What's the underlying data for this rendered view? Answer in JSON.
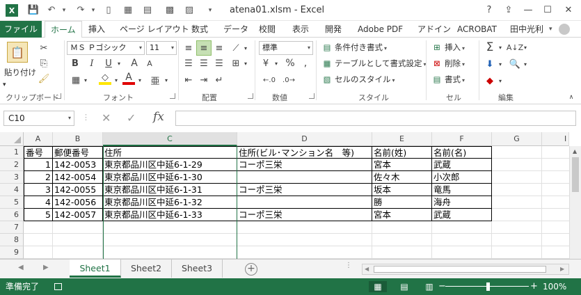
{
  "window": {
    "title": "atena01.xlsm - Excel",
    "app_badge": "X",
    "help": "?",
    "ribbon_options": "⇪",
    "minimize": "—",
    "maximize": "☐",
    "close": "✕"
  },
  "quick_access": {
    "save": "💾",
    "undo": "↶",
    "redo": "↷",
    "new": "▯",
    "customize": "▾"
  },
  "ribbon_tabs": {
    "file": "ファイル",
    "home": "ホーム",
    "insert": "挿入",
    "page_layout": "ページ レイアウト",
    "formulas": "数式",
    "data": "データ",
    "review": "校閲",
    "view": "表示",
    "developer": "開発",
    "adobe_pdf": "Adobe PDF",
    "addins": "アドイン",
    "acrobat": "ACROBAT",
    "user": "田中光利"
  },
  "ribbon": {
    "clipboard": {
      "label": "クリップボード",
      "paste": "貼り付け"
    },
    "font": {
      "label": "フォント",
      "font_name": "ＭＳ Ｐゴシック",
      "font_size": "11",
      "bold": "B",
      "italic": "I",
      "underline": "U",
      "grow": "A",
      "shrink": "A",
      "color": "A",
      "phonetic": "亜"
    },
    "alignment": {
      "label": "配置"
    },
    "number": {
      "label": "数値",
      "format": "標準",
      "percent": "%",
      "comma": ","
    },
    "styles": {
      "label": "スタイル",
      "conditional": "条件付き書式",
      "table": "テーブルとして書式設定",
      "cell_styles": "セルのスタイル"
    },
    "cells": {
      "label": "セル",
      "insert": "挿入",
      "delete": "削除",
      "format": "書式"
    },
    "editing": {
      "label": "編集",
      "sum": "Σ"
    }
  },
  "formula_bar": {
    "name_box": "C10",
    "cancel": "✕",
    "enter": "✓",
    "fx": "fx",
    "value": ""
  },
  "sheet": {
    "columns": [
      "A",
      "B",
      "C",
      "D",
      "E",
      "F",
      "G",
      "I"
    ],
    "row_numbers": [
      "1",
      "2",
      "3",
      "4",
      "5",
      "6",
      "7",
      "8",
      "9"
    ],
    "rows": [
      [
        "番号",
        "郵便番号",
        "住所",
        "住所(ビル･マンション名　等)",
        "名前(姓)",
        "名前(名)"
      ],
      [
        "1",
        "142-0053",
        "東京都品川区中延6-1-29",
        "コーポ三栄",
        "宮本",
        "武蔵"
      ],
      [
        "2",
        "142-0054",
        "東京都品川区中延6-1-30",
        "",
        "佐々木",
        "小次郎"
      ],
      [
        "3",
        "142-0055",
        "東京都品川区中延6-1-31",
        "コーポ三栄",
        "坂本",
        "竜馬"
      ],
      [
        "4",
        "142-0056",
        "東京都品川区中延6-1-32",
        "",
        "勝",
        "海舟"
      ],
      [
        "5",
        "142-0057",
        "東京都品川区中延6-1-33",
        "コーポ三栄",
        "宮本",
        "武蔵"
      ]
    ]
  },
  "sheet_tabs": {
    "tabs": [
      "Sheet1",
      "Sheet2",
      "Sheet3"
    ],
    "active": "Sheet1",
    "add": "+"
  },
  "status_bar": {
    "status": "準備完了",
    "zoom_out": "−",
    "zoom_in": "+",
    "zoom": "100%"
  },
  "colors": {
    "accent": "#217346",
    "selected_column_header": "#e1e1e1"
  }
}
